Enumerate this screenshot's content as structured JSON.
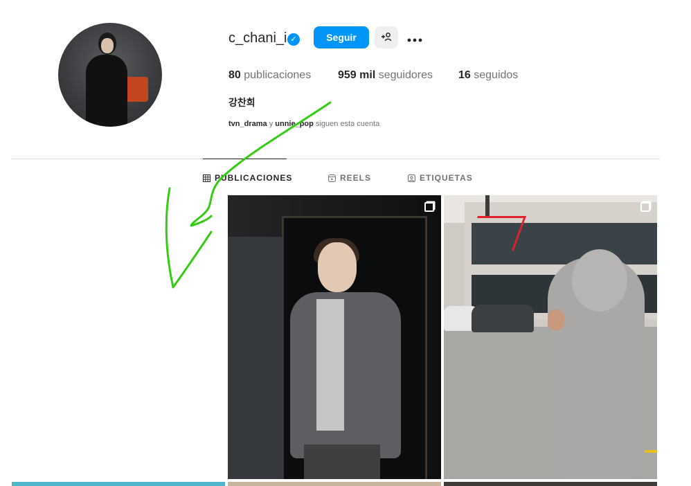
{
  "profile": {
    "username": "c_chani_i",
    "verified": true,
    "follow_label": "Seguir",
    "suggest_label": "+웃",
    "more_label": "•••",
    "full_name": "강찬희",
    "stats": {
      "posts_value": "80",
      "posts_label": "publicaciones",
      "followers_value": "959 mil",
      "followers_label": "seguidores",
      "following_value": "16",
      "following_label": "seguidos"
    },
    "followed_by": {
      "user1": "tvn_drama",
      "connector": "y",
      "user2": "unnie_pop",
      "suffix": "siguen esta cuenta"
    }
  },
  "tabs": [
    {
      "label": "PUBLICACIONES",
      "icon": "grid-icon",
      "active": true
    },
    {
      "label": "REELS",
      "icon": "reels-icon",
      "active": false
    },
    {
      "label": "ETIQUETAS",
      "icon": "tag-icon",
      "active": false
    }
  ],
  "posts": [
    {
      "type": "carousel",
      "description_icon": "multiple-images-icon"
    },
    {
      "type": "carousel",
      "description_icon": "multiple-images-icon"
    }
  ],
  "colors": {
    "accent": "#0095f6",
    "annotation": "#33cc11",
    "text": "#262626",
    "secondary_text": "#737373",
    "divider": "#dbdbdb"
  }
}
